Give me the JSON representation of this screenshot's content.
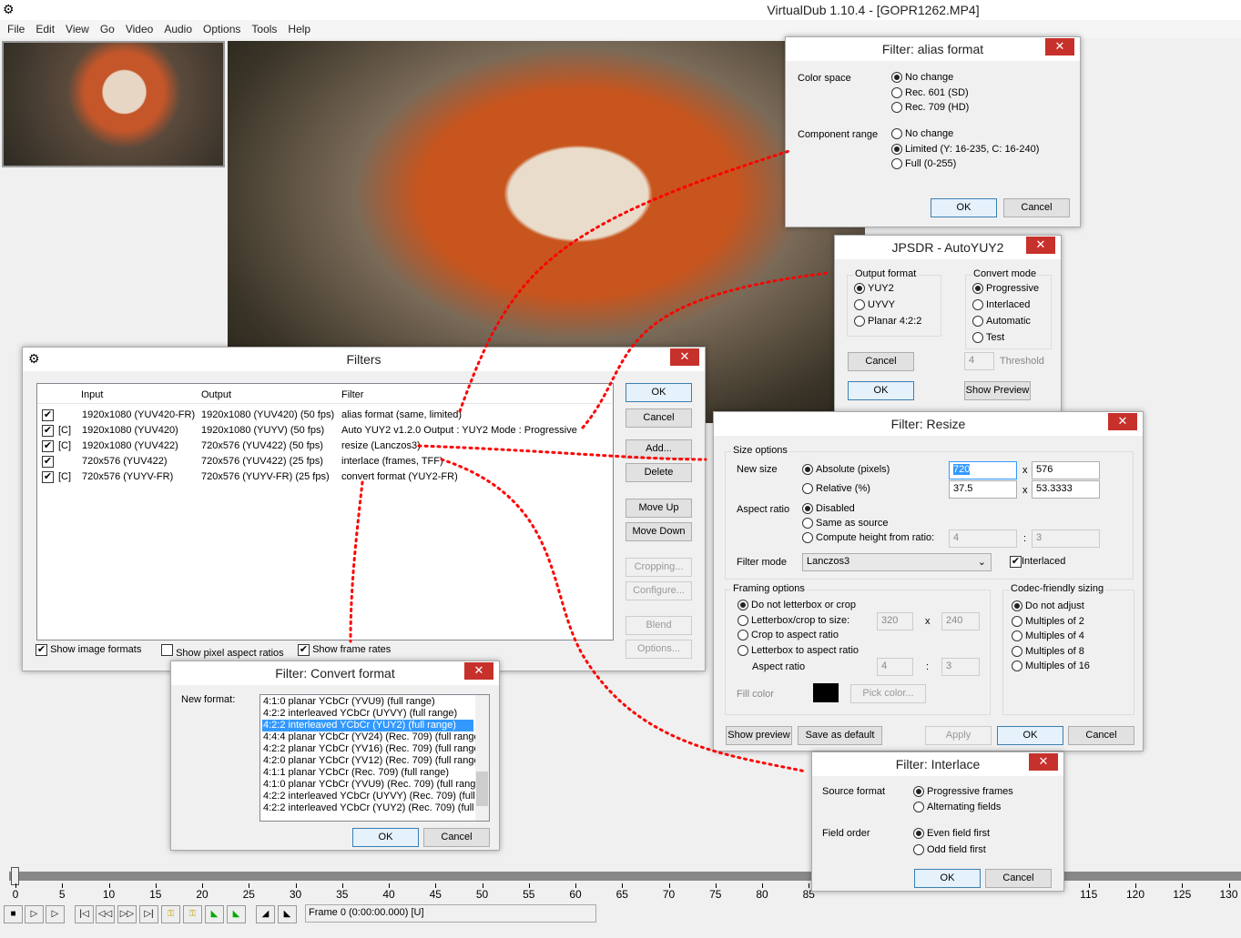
{
  "app": {
    "title": "VirtualDub 1.10.4 - [GOPR1262.MP4]",
    "menu": [
      "File",
      "Edit",
      "View",
      "Go",
      "Video",
      "Audio",
      "Options",
      "Tools",
      "Help"
    ]
  },
  "filters": {
    "title": "Filters",
    "headers": [
      "Input",
      "Output",
      "Filter"
    ],
    "rows": [
      {
        "checked": true,
        "c": "",
        "input": "1920x1080 (YUV420-FR)",
        "output": "1920x1080 (YUV420) (50 fps)",
        "filter": "alias format (same, limited)"
      },
      {
        "checked": true,
        "c": "[C]",
        "input": "1920x1080 (YUV420)",
        "output": "1920x1080 (YUYV) (50 fps)",
        "filter": "Auto YUY2 v1.2.0 Output : YUY2 Mode : Progressive"
      },
      {
        "checked": true,
        "c": "[C]",
        "input": "1920x1080 (YUV422)",
        "output": "720x576 (YUV422) (50 fps)",
        "filter": "resize (Lanczos3)"
      },
      {
        "checked": true,
        "c": "",
        "input": "720x576 (YUV422)",
        "output": "720x576 (YUV422) (25 fps)",
        "filter": "interlace (frames, TFF)"
      },
      {
        "checked": true,
        "c": "[C]",
        "input": "720x576 (YUYV-FR)",
        "output": "720x576 (YUYV-FR) (25 fps)",
        "filter": "convert format (YUY2-FR)"
      }
    ],
    "buttons": {
      "ok": "OK",
      "cancel": "Cancel",
      "add": "Add...",
      "delete": "Delete",
      "move_up": "Move Up",
      "move_down": "Move Down",
      "cropping": "Cropping...",
      "configure": "Configure...",
      "blend": "Blend",
      "options": "Options..."
    },
    "show_image_formats": "Show image formats",
    "show_pixel_aspect": "Show pixel aspect ratios",
    "show_frame_rates": "Show frame rates"
  },
  "alias": {
    "title": "Filter: alias format",
    "color_space": "Color space",
    "cs_options": [
      "No change",
      "Rec. 601 (SD)",
      "Rec. 709 (HD)"
    ],
    "cs_selected": 0,
    "component_range": "Component range",
    "cr_options": [
      "No change",
      "Limited (Y: 16-235, C: 16-240)",
      "Full (0-255)"
    ],
    "cr_selected": 1,
    "ok": "OK",
    "cancel": "Cancel"
  },
  "jpsdr": {
    "title": "JPSDR - AutoYUY2",
    "output_format": "Output format",
    "of_options": [
      "YUY2",
      "UYVY",
      "Planar 4:2:2"
    ],
    "of_selected": 0,
    "convert_mode": "Convert mode",
    "cm_options": [
      "Progressive",
      "Interlaced",
      "Automatic",
      "Test"
    ],
    "cm_selected": 0,
    "threshold_value": "4",
    "threshold": "Threshold",
    "cancel": "Cancel",
    "ok": "OK",
    "show_preview": "Show Preview"
  },
  "resize": {
    "title": "Filter: Resize",
    "size_options": "Size options",
    "new_size": "New size",
    "absolute": "Absolute (pixels)",
    "relative": "Relative (%)",
    "abs_w": "720",
    "abs_h": "576",
    "rel_w": "37.5",
    "rel_h": "53.3333",
    "x": "x",
    "aspect_ratio": "Aspect ratio",
    "ar_disabled": "Disabled",
    "ar_same": "Same as source",
    "ar_compute": "Compute height from ratio:",
    "ratio_a": "4",
    "ratio_b": "3",
    "colon": ":",
    "filter_mode": "Filter mode",
    "filter_mode_value": "Lanczos3",
    "interlaced": "Interlaced",
    "framing": "Framing options",
    "fr_options": [
      "Do not letterbox or crop",
      "Letterbox/crop to size:",
      "Crop to aspect ratio",
      "Letterbox to aspect ratio"
    ],
    "fr_w": "320",
    "fr_h": "240",
    "fr_aspect": "Aspect ratio",
    "fr_a": "4",
    "fr_b": "3",
    "fill_color": "Fill color",
    "fill_color_value": "#000000",
    "pick_color": "Pick color...",
    "codec": "Codec-friendly sizing",
    "codec_options": [
      "Do not adjust",
      "Multiples of 2",
      "Multiples of 4",
      "Multiples of 8",
      "Multiples of 16"
    ],
    "show_preview": "Show preview",
    "save_default": "Save as default",
    "apply": "Apply",
    "ok": "OK",
    "cancel": "Cancel"
  },
  "convert": {
    "title": "Filter: Convert format",
    "new_format": "New format:",
    "options": [
      "4:1:0 planar YCbCr (YVU9) (full range)",
      "4:2:2 interleaved YCbCr (UYVY) (full range)",
      "4:2:2 interleaved YCbCr (YUY2) (full range)",
      "4:4:4 planar YCbCr (YV24) (Rec. 709) (full range",
      "4:2:2 planar YCbCr (YV16) (Rec. 709) (full range",
      "4:2:0 planar YCbCr (YV12) (Rec. 709) (full range",
      "4:1:1 planar YCbCr (Rec. 709) (full range)",
      "4:1:0 planar YCbCr (YVU9) (Rec. 709) (full range",
      "4:2:2 interleaved YCbCr (UYVY) (Rec. 709) (full r",
      "4:2:2 interleaved YCbCr (YUY2) (Rec. 709) (full r"
    ],
    "selected": 2,
    "ok": "OK",
    "cancel": "Cancel"
  },
  "interlace": {
    "title": "Filter: Interlace",
    "source_format": "Source format",
    "sf_options": [
      "Progressive frames",
      "Alternating fields"
    ],
    "sf_selected": 0,
    "field_order": "Field order",
    "fo_options": [
      "Even field first",
      "Odd field first"
    ],
    "fo_selected": 0,
    "ok": "OK",
    "cancel": "Cancel"
  },
  "timeline": {
    "ticks": [
      "0",
      "5",
      "10",
      "15",
      "20",
      "25",
      "30",
      "35",
      "40",
      "45",
      "50",
      "55",
      "60",
      "65",
      "70",
      "75",
      "80",
      "85",
      "",
      "",
      "",
      "",
      "",
      "115",
      "120",
      "125",
      "130"
    ],
    "position": 0,
    "frame_status": "Frame 0 (0:00:00.000) [U]"
  },
  "colors": {
    "accent": "#3399ff",
    "close": "#c7312b",
    "annotation": "#ff0000"
  }
}
